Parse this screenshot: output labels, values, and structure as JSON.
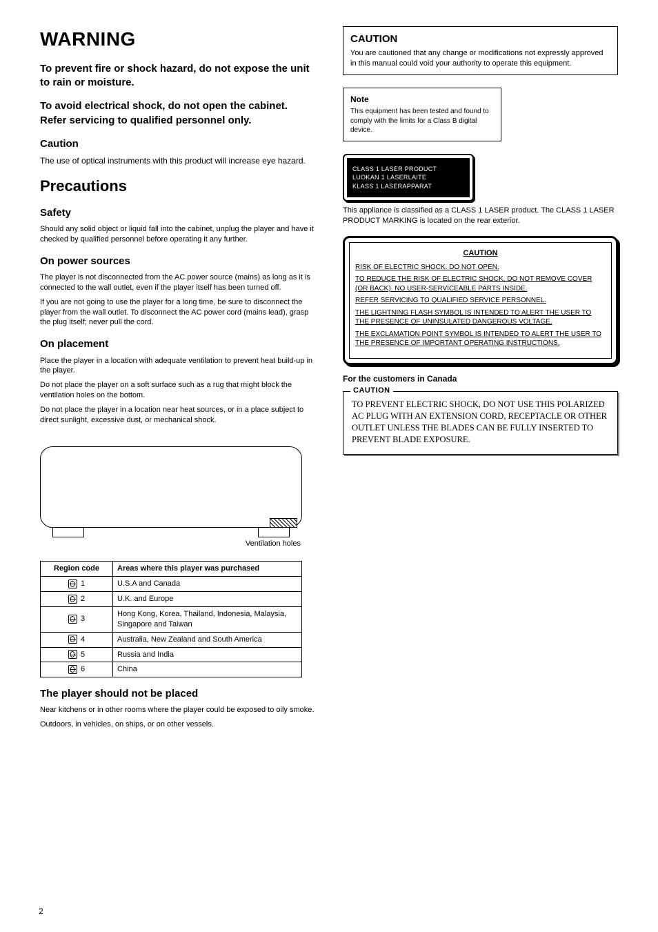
{
  "page_number": "2",
  "left": {
    "warning": "WARNING",
    "warning_sub": "To prevent fire or shock hazard, do not expose the unit to rain or moisture.",
    "shock_sub": "To avoid electrical shock, do not open the cabinet. Refer servicing to qualified personnel only.",
    "caution_title": "Caution",
    "caution_para": "The use of optical instruments with this product will increase eye hazard.",
    "precautions_title": "Precautions",
    "safety_title": "Safety",
    "safety_body": "Should any solid object or liquid fall into the cabinet, unplug the player and have it checked by qualified personnel before operating it any further.",
    "power_title": "On power sources",
    "power_items": [
      "The player is not disconnected from the AC power source (mains) as long as it is connected to the wall outlet, even if the player itself has been turned off.",
      "If you are not going to use the player for a long time, be sure to disconnect the player from the wall outlet. To disconnect the AC power cord (mains lead), grasp the plug itself; never pull the cord."
    ],
    "placement_title": "On placement",
    "placement_items": [
      "Place the player in a location with adequate ventilation to prevent heat build-up in the player.",
      "Do not place the player on a soft surface such as a rug that might block the ventilation holes on the bottom.",
      "Do not place the player in a location near heat sources, or in a place subject to direct sunlight, excessive dust, or mechanical shock."
    ],
    "vent_label": "Ventilation holes",
    "region_head_code": "Region code",
    "region_head_area": "Areas where this player was purchased",
    "regions": [
      {
        "code": "1",
        "area": "U.S.A and Canada"
      },
      {
        "code": "2",
        "area": "U.K. and Europe"
      },
      {
        "code": "3",
        "area": "Hong Kong, Korea, Thailand, Indonesia, Malaysia, Singapore and Taiwan"
      },
      {
        "code": "4",
        "area": "Australia, New Zealand and South America"
      },
      {
        "code": "5",
        "area": "Russia and India"
      },
      {
        "code": "6",
        "area": "China"
      }
    ],
    "not_place_title": "The player should not be placed",
    "not_place_items": [
      "Near kitchens or in other rooms where the player could be exposed to oily smoke.",
      "Outdoors, in vehicles, on ships, or on other vessels."
    ]
  },
  "right": {
    "fcc_head": "CAUTION",
    "fcc_body": "You are cautioned that any change or modifications not expressly approved in this manual could void your authority to operate this equipment.",
    "note_head": "Note",
    "note_body": "This equipment has been tested and found to comply with the limits for a Class B digital device.",
    "laser": {
      "lines": [
        "CLASS 1 LASER PRODUCT",
        "LUOKAN 1 LASERLAITE",
        "KLASS 1 LASERAPPARAT"
      ],
      "para": "This appliance is classified as a CLASS 1 LASER product. The CLASS 1 LASER PRODUCT MARKING is located on the rear exterior."
    },
    "caution_block": {
      "head": "CAUTION",
      "p1": "RISK OF ELECTRIC SHOCK. DO NOT OPEN.",
      "p2": "TO REDUCE THE RISK OF ELECTRIC SHOCK, DO NOT REMOVE COVER (OR BACK). NO USER-SERVICEABLE PARTS INSIDE.",
      "p3": "REFER SERVICING TO QUALIFIED SERVICE PERSONNEL.",
      "p4": "THE LIGHTNING FLASH SYMBOL IS INTENDED TO ALERT THE USER TO THE PRESENCE OF UNINSULATED DANGEROUS VOLTAGE.",
      "p5": "THE EXCLAMATION POINT SYMBOL IS INTENDED TO ALERT THE USER TO THE PRESENCE OF IMPORTANT OPERATING INSTRUCTIONS."
    },
    "canada_head": "For the customers in Canada",
    "canada_legend": "CAUTION",
    "canada_body": "TO PREVENT ELECTRIC SHOCK, DO NOT USE THIS POLARIZED AC PLUG WITH AN EXTENSION CORD, RECEPTACLE OR OTHER OUTLET UNLESS THE BLADES CAN BE FULLY INSERTED TO PREVENT BLADE EXPOSURE."
  }
}
